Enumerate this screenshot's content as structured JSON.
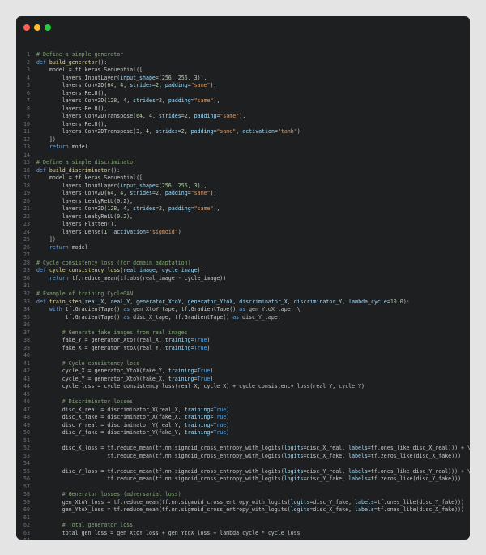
{
  "window": {
    "controls": [
      "close",
      "minimize",
      "maximize"
    ]
  },
  "editor": {
    "language": "python",
    "lines": [
      [
        [
          "cm",
          "# Define a simple generator"
        ]
      ],
      [
        [
          "kw",
          "def "
        ],
        [
          "fn",
          "build_generator"
        ],
        [
          "p",
          "():"
        ]
      ],
      [
        [
          "p",
          "    model = tf.keras.Sequential(["
        ]
      ],
      [
        [
          "p",
          "        layers.InputLayer("
        ],
        [
          "param",
          "input_shape"
        ],
        [
          "p",
          "=("
        ],
        [
          "num",
          "256"
        ],
        [
          "p",
          ", "
        ],
        [
          "num",
          "256"
        ],
        [
          "p",
          ", "
        ],
        [
          "num",
          "3"
        ],
        [
          "p",
          ")),"
        ]
      ],
      [
        [
          "p",
          "        layers.Conv2D("
        ],
        [
          "num",
          "64"
        ],
        [
          "p",
          ", "
        ],
        [
          "num",
          "4"
        ],
        [
          "p",
          ", "
        ],
        [
          "param",
          "strides"
        ],
        [
          "p",
          "="
        ],
        [
          "num",
          "2"
        ],
        [
          "p",
          ", "
        ],
        [
          "param",
          "padding"
        ],
        [
          "p",
          "="
        ],
        [
          "str",
          "\"same\""
        ],
        [
          "p",
          "),"
        ]
      ],
      [
        [
          "p",
          "        layers.ReLU(),"
        ]
      ],
      [
        [
          "p",
          "        layers.Conv2D("
        ],
        [
          "num",
          "128"
        ],
        [
          "p",
          ", "
        ],
        [
          "num",
          "4"
        ],
        [
          "p",
          ", "
        ],
        [
          "param",
          "strides"
        ],
        [
          "p",
          "="
        ],
        [
          "num",
          "2"
        ],
        [
          "p",
          ", "
        ],
        [
          "param",
          "padding"
        ],
        [
          "p",
          "="
        ],
        [
          "str",
          "\"same\""
        ],
        [
          "p",
          "),"
        ]
      ],
      [
        [
          "p",
          "        layers.ReLU(),"
        ]
      ],
      [
        [
          "p",
          "        layers.Conv2DTranspose("
        ],
        [
          "num",
          "64"
        ],
        [
          "p",
          ", "
        ],
        [
          "num",
          "4"
        ],
        [
          "p",
          ", "
        ],
        [
          "param",
          "strides"
        ],
        [
          "p",
          "="
        ],
        [
          "num",
          "2"
        ],
        [
          "p",
          ", "
        ],
        [
          "param",
          "padding"
        ],
        [
          "p",
          "="
        ],
        [
          "str",
          "\"same\""
        ],
        [
          "p",
          "),"
        ]
      ],
      [
        [
          "p",
          "        layers.ReLU(),"
        ]
      ],
      [
        [
          "p",
          "        layers.Conv2DTranspose("
        ],
        [
          "num",
          "3"
        ],
        [
          "p",
          ", "
        ],
        [
          "num",
          "4"
        ],
        [
          "p",
          ", "
        ],
        [
          "param",
          "strides"
        ],
        [
          "p",
          "="
        ],
        [
          "num",
          "2"
        ],
        [
          "p",
          ", "
        ],
        [
          "param",
          "padding"
        ],
        [
          "p",
          "="
        ],
        [
          "str",
          "\"same\""
        ],
        [
          "p",
          ", "
        ],
        [
          "param",
          "activation"
        ],
        [
          "p",
          "="
        ],
        [
          "str",
          "\"tanh\""
        ],
        [
          "p",
          ")"
        ]
      ],
      [
        [
          "p",
          "    ])"
        ]
      ],
      [
        [
          "p",
          "    "
        ],
        [
          "kw",
          "return "
        ],
        [
          "p",
          "model"
        ]
      ],
      [],
      [
        [
          "cm",
          "# Define a simple discriminator"
        ]
      ],
      [
        [
          "kw",
          "def "
        ],
        [
          "fn",
          "build_discriminator"
        ],
        [
          "p",
          "():"
        ]
      ],
      [
        [
          "p",
          "    model = tf.keras.Sequential(["
        ]
      ],
      [
        [
          "p",
          "        layers.InputLayer("
        ],
        [
          "param",
          "input_shape"
        ],
        [
          "p",
          "=("
        ],
        [
          "num",
          "256"
        ],
        [
          "p",
          ", "
        ],
        [
          "num",
          "256"
        ],
        [
          "p",
          ", "
        ],
        [
          "num",
          "3"
        ],
        [
          "p",
          ")),"
        ]
      ],
      [
        [
          "p",
          "        layers.Conv2D("
        ],
        [
          "num",
          "64"
        ],
        [
          "p",
          ", "
        ],
        [
          "num",
          "4"
        ],
        [
          "p",
          ", "
        ],
        [
          "param",
          "strides"
        ],
        [
          "p",
          "="
        ],
        [
          "num",
          "2"
        ],
        [
          "p",
          ", "
        ],
        [
          "param",
          "padding"
        ],
        [
          "p",
          "="
        ],
        [
          "str",
          "\"same\""
        ],
        [
          "p",
          "),"
        ]
      ],
      [
        [
          "p",
          "        layers.LeakyReLU("
        ],
        [
          "num",
          "0.2"
        ],
        [
          "p",
          "),"
        ]
      ],
      [
        [
          "p",
          "        layers.Conv2D("
        ],
        [
          "num",
          "128"
        ],
        [
          "p",
          ", "
        ],
        [
          "num",
          "4"
        ],
        [
          "p",
          ", "
        ],
        [
          "param",
          "strides"
        ],
        [
          "p",
          "="
        ],
        [
          "num",
          "2"
        ],
        [
          "p",
          ", "
        ],
        [
          "param",
          "padding"
        ],
        [
          "p",
          "="
        ],
        [
          "str",
          "\"same\""
        ],
        [
          "p",
          "),"
        ]
      ],
      [
        [
          "p",
          "        layers.LeakyReLU("
        ],
        [
          "num",
          "0.2"
        ],
        [
          "p",
          "),"
        ]
      ],
      [
        [
          "p",
          "        layers.Flatten(),"
        ]
      ],
      [
        [
          "p",
          "        layers.Dense("
        ],
        [
          "num",
          "1"
        ],
        [
          "p",
          ", "
        ],
        [
          "param",
          "activation"
        ],
        [
          "p",
          "="
        ],
        [
          "str",
          "\"sigmoid\""
        ],
        [
          "p",
          ")"
        ]
      ],
      [
        [
          "p",
          "    ])"
        ]
      ],
      [
        [
          "p",
          "    "
        ],
        [
          "kw",
          "return "
        ],
        [
          "p",
          "model"
        ]
      ],
      [],
      [
        [
          "cm",
          "# Cycle consistency loss (for domain adaptation)"
        ]
      ],
      [
        [
          "kw",
          "def "
        ],
        [
          "fn",
          "cycle_consistency_loss"
        ],
        [
          "p",
          "("
        ],
        [
          "param",
          "real_image"
        ],
        [
          "p",
          ", "
        ],
        [
          "param",
          "cycle_image"
        ],
        [
          "p",
          "):"
        ]
      ],
      [
        [
          "p",
          "    "
        ],
        [
          "kw",
          "return "
        ],
        [
          "p",
          "tf.reduce_mean(tf.abs(real_image - cycle_image))"
        ]
      ],
      [],
      [
        [
          "cm",
          "# Example of training CycleGAN"
        ]
      ],
      [
        [
          "kw",
          "def "
        ],
        [
          "fn",
          "train_step"
        ],
        [
          "p",
          "("
        ],
        [
          "param",
          "real_X"
        ],
        [
          "p",
          ", "
        ],
        [
          "param",
          "real_Y"
        ],
        [
          "p",
          ", "
        ],
        [
          "param",
          "generator_XtoY"
        ],
        [
          "p",
          ", "
        ],
        [
          "param",
          "generator_YtoX"
        ],
        [
          "p",
          ", "
        ],
        [
          "param",
          "discriminator_X"
        ],
        [
          "p",
          ", "
        ],
        [
          "param",
          "discriminator_Y"
        ],
        [
          "p",
          ", "
        ],
        [
          "param",
          "lambda_cycle"
        ],
        [
          "p",
          "="
        ],
        [
          "num",
          "10.0"
        ],
        [
          "p",
          "):"
        ]
      ],
      [
        [
          "p",
          "    "
        ],
        [
          "kw",
          "with "
        ],
        [
          "p",
          "tf.GradientTape() "
        ],
        [
          "kw",
          "as "
        ],
        [
          "p",
          "gen_XtoY_tape, tf.GradientTape() "
        ],
        [
          "kw",
          "as "
        ],
        [
          "p",
          "gen_YtoX_tape, \\"
        ]
      ],
      [
        [
          "p",
          "         tf.GradientTape() "
        ],
        [
          "kw",
          "as "
        ],
        [
          "p",
          "disc_X_tape, tf.GradientTape() "
        ],
        [
          "kw",
          "as "
        ],
        [
          "p",
          "disc_Y_tape:"
        ]
      ],
      [],
      [
        [
          "p",
          "        "
        ],
        [
          "cm",
          "# Generate fake images from real images"
        ]
      ],
      [
        [
          "p",
          "        fake_Y = generator_XtoY(real_X, "
        ],
        [
          "param",
          "training"
        ],
        [
          "p",
          "="
        ],
        [
          "const",
          "True"
        ],
        [
          "p",
          ")"
        ]
      ],
      [
        [
          "p",
          "        fake_X = generator_YtoX(real_Y, "
        ],
        [
          "param",
          "training"
        ],
        [
          "p",
          "="
        ],
        [
          "const",
          "True"
        ],
        [
          "p",
          ")"
        ]
      ],
      [],
      [
        [
          "p",
          "        "
        ],
        [
          "cm",
          "# Cycle consistency loss"
        ]
      ],
      [
        [
          "p",
          "        cycle_X = generator_YtoX(fake_Y, "
        ],
        [
          "param",
          "training"
        ],
        [
          "p",
          "="
        ],
        [
          "const",
          "True"
        ],
        [
          "p",
          ")"
        ]
      ],
      [
        [
          "p",
          "        cycle_Y = generator_XtoY(fake_X, "
        ],
        [
          "param",
          "training"
        ],
        [
          "p",
          "="
        ],
        [
          "const",
          "True"
        ],
        [
          "p",
          ")"
        ]
      ],
      [
        [
          "p",
          "        cycle_loss = cycle_consistency_loss(real_X, cycle_X) + cycle_consistency_loss(real_Y, cycle_Y)"
        ]
      ],
      [],
      [
        [
          "p",
          "        "
        ],
        [
          "cm",
          "# Discriminator losses"
        ]
      ],
      [
        [
          "p",
          "        disc_X_real = discriminator_X(real_X, "
        ],
        [
          "param",
          "training"
        ],
        [
          "p",
          "="
        ],
        [
          "const",
          "True"
        ],
        [
          "p",
          ")"
        ]
      ],
      [
        [
          "p",
          "        disc_X_fake = discriminator_X(fake_X, "
        ],
        [
          "param",
          "training"
        ],
        [
          "p",
          "="
        ],
        [
          "const",
          "True"
        ],
        [
          "p",
          ")"
        ]
      ],
      [
        [
          "p",
          "        disc_Y_real = discriminator_Y(real_Y, "
        ],
        [
          "param",
          "training"
        ],
        [
          "p",
          "="
        ],
        [
          "const",
          "True"
        ],
        [
          "p",
          ")"
        ]
      ],
      [
        [
          "p",
          "        disc_Y_fake = discriminator_Y(fake_Y, "
        ],
        [
          "param",
          "training"
        ],
        [
          "p",
          "="
        ],
        [
          "const",
          "True"
        ],
        [
          "p",
          ")"
        ]
      ],
      [],
      [
        [
          "p",
          "        disc_X_loss = tf.reduce_mean(tf.nn.sigmoid_cross_entropy_with_logits("
        ],
        [
          "param",
          "logits"
        ],
        [
          "p",
          "=disc_X_real, "
        ],
        [
          "param",
          "labels"
        ],
        [
          "p",
          "=tf.ones_like(disc_X_real))) + \\"
        ]
      ],
      [
        [
          "p",
          "                      tf.reduce_mean(tf.nn.sigmoid_cross_entropy_with_logits("
        ],
        [
          "param",
          "logits"
        ],
        [
          "p",
          "=disc_X_fake, "
        ],
        [
          "param",
          "labels"
        ],
        [
          "p",
          "=tf.zeros_like(disc_X_fake)))"
        ]
      ],
      [],
      [
        [
          "p",
          "        disc_Y_loss = tf.reduce_mean(tf.nn.sigmoid_cross_entropy_with_logits("
        ],
        [
          "param",
          "logits"
        ],
        [
          "p",
          "=disc_Y_real, "
        ],
        [
          "param",
          "labels"
        ],
        [
          "p",
          "=tf.ones_like(disc_Y_real))) + \\"
        ]
      ],
      [
        [
          "p",
          "                      tf.reduce_mean(tf.nn.sigmoid_cross_entropy_with_logits("
        ],
        [
          "param",
          "logits"
        ],
        [
          "p",
          "=disc_Y_fake, "
        ],
        [
          "param",
          "labels"
        ],
        [
          "p",
          "=tf.zeros_like(disc_Y_fake)))"
        ]
      ],
      [],
      [
        [
          "p",
          "        "
        ],
        [
          "cm",
          "# Generator losses (adversarial loss)"
        ]
      ],
      [
        [
          "p",
          "        gen_XtoY_loss = tf.reduce_mean(tf.nn.sigmoid_cross_entropy_with_logits("
        ],
        [
          "param",
          "logits"
        ],
        [
          "p",
          "=disc_Y_fake, "
        ],
        [
          "param",
          "labels"
        ],
        [
          "p",
          "=tf.ones_like(disc_Y_fake)))"
        ]
      ],
      [
        [
          "p",
          "        gen_YtoX_loss = tf.reduce_mean(tf.nn.sigmoid_cross_entropy_with_logits("
        ],
        [
          "param",
          "logits"
        ],
        [
          "p",
          "=disc_X_fake, "
        ],
        [
          "param",
          "labels"
        ],
        [
          "p",
          "=tf.ones_like(disc_X_fake)))"
        ]
      ],
      [],
      [
        [
          "p",
          "        "
        ],
        [
          "cm",
          "# Total generator loss"
        ]
      ],
      [
        [
          "p",
          "        total_gen_loss = gen_XtoY_loss + gen_YtoX_loss + lambda_cycle * cycle_loss"
        ]
      ],
      []
    ]
  }
}
